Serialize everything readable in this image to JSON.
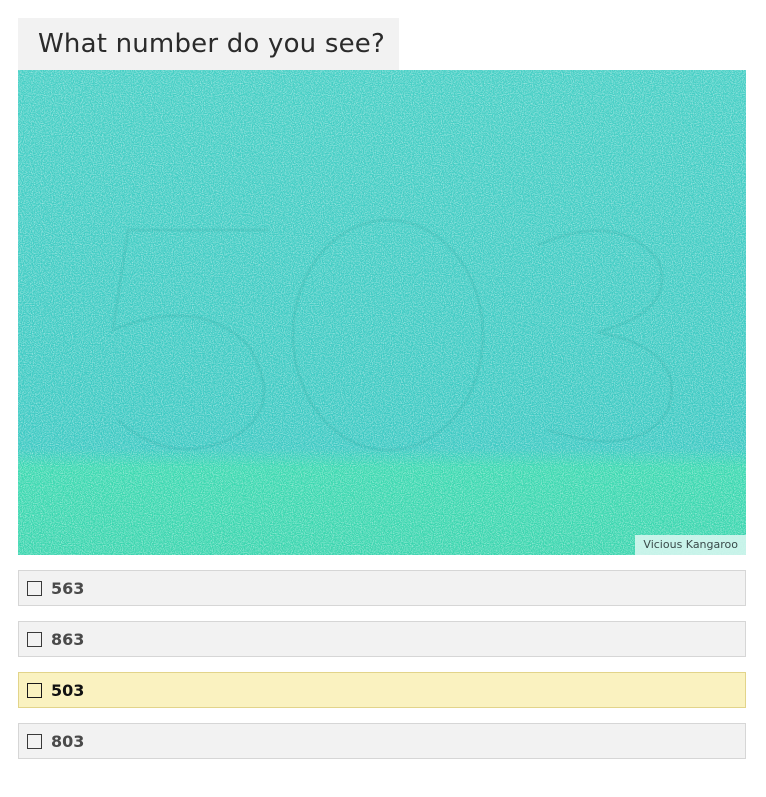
{
  "question": {
    "title": "What number do you see?"
  },
  "image": {
    "description_icon": "color-blindness-test-plate",
    "base_color": "#3ccfc2",
    "credit": "Vicious Kangaroo"
  },
  "options": [
    {
      "label": "563",
      "checked": false,
      "highlighted": false
    },
    {
      "label": "863",
      "checked": false,
      "highlighted": false
    },
    {
      "label": "503",
      "checked": false,
      "highlighted": true
    },
    {
      "label": "803",
      "checked": false,
      "highlighted": false
    }
  ],
  "colors": {
    "option_bg": "#f2f2f2",
    "option_highlight_bg": "#faf2c0",
    "question_bg": "#f2f2f2"
  }
}
